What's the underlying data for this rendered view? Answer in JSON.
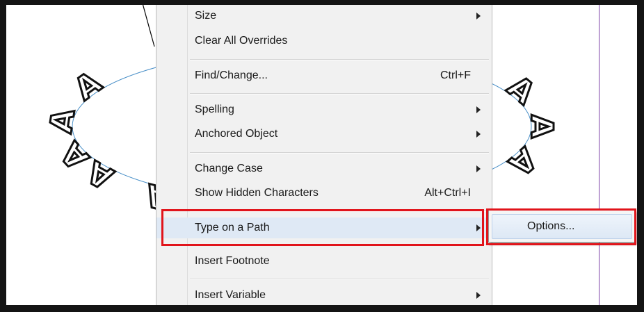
{
  "menu": {
    "items": [
      {
        "label": "Size",
        "submenu": true
      },
      {
        "label": "Clear All Overrides"
      },
      {
        "label": "Find/Change...",
        "shortcut": "Ctrl+F"
      },
      {
        "label": "Spelling",
        "submenu": true
      },
      {
        "label": "Anchored Object",
        "submenu": true
      },
      {
        "label": "Change Case",
        "submenu": true
      },
      {
        "label": "Show Hidden Characters",
        "shortcut": "Alt+Ctrl+I"
      },
      {
        "label": "Type on a Path",
        "submenu": true,
        "highlighted": true
      },
      {
        "label": "Insert Footnote"
      },
      {
        "label": "Insert Variable",
        "submenu": true
      }
    ]
  },
  "submenu": {
    "items": [
      {
        "label": "Options..."
      }
    ]
  },
  "artwork": {
    "glyph": "A",
    "path_color": "#4a90c8",
    "guide_color": "#7b3fa6"
  },
  "colors": {
    "callout": "#e1141b",
    "highlight": "#dfe9f5",
    "menu_bg": "#f1f1f1"
  }
}
